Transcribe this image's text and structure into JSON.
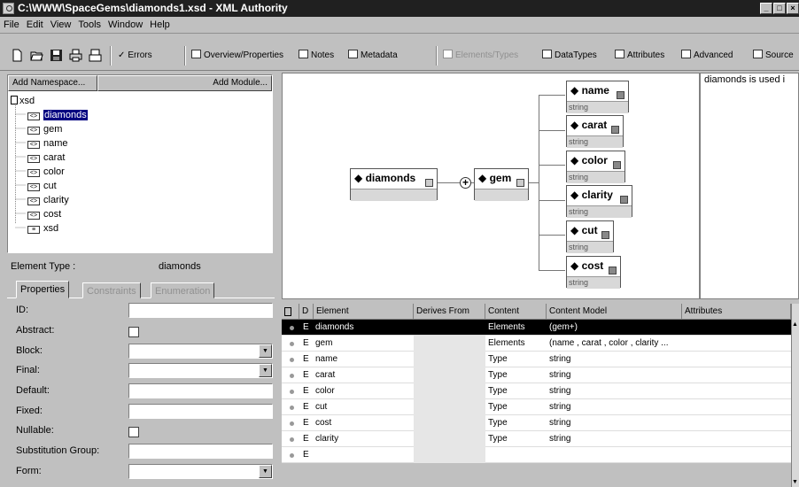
{
  "window": {
    "title": "C:\\WWW\\SpaceGems\\diamonds1.xsd - XML Authority"
  },
  "menu": [
    "File",
    "Edit",
    "View",
    "Tools",
    "Window",
    "Help"
  ],
  "toolbar": {
    "errors": "Errors",
    "overview": "Overview/Properties",
    "notes": "Notes",
    "metadata": "Metadata",
    "elements_types": "Elements/Types",
    "datatypes": "DataTypes",
    "attributes": "Attributes",
    "advanced": "Advanced",
    "source": "Source"
  },
  "tree": {
    "add_namespace": "Add Namespace...",
    "add_module": "Add Module...",
    "root": "xsd",
    "items": [
      "diamonds",
      "gem",
      "name",
      "carat",
      "color",
      "cut",
      "clarity",
      "cost",
      "xsd"
    ],
    "selected_index": 0
  },
  "element_panel": {
    "label": "Element Type :",
    "value": "diamonds",
    "tabs": [
      "Properties",
      "Constraints",
      "Enumeration"
    ],
    "fields": {
      "id": "ID:",
      "abstract": "Abstract:",
      "block": "Block:",
      "final": "Final:",
      "default": "Default:",
      "fixed": "Fixed:",
      "nullable": "Nullable:",
      "subst": "Substitution Group:",
      "form": "Form:"
    }
  },
  "diagram": {
    "root": "diamonds",
    "child": "gem",
    "leaves": [
      {
        "name": "name",
        "type": "string"
      },
      {
        "name": "carat",
        "type": "string"
      },
      {
        "name": "color",
        "type": "string"
      },
      {
        "name": "clarity",
        "type": "string"
      },
      {
        "name": "cut",
        "type": "string"
      },
      {
        "name": "cost",
        "type": "string"
      }
    ]
  },
  "usage": {
    "text": "diamonds is used i"
  },
  "grid": {
    "headers": {
      "d": "D",
      "element": "Element",
      "derives": "Derives From",
      "content": "Content",
      "model": "Content Model",
      "attributes": "Attributes"
    },
    "rows": [
      {
        "d": "E",
        "element": "diamonds",
        "content": "Elements",
        "model": "(gem+)"
      },
      {
        "d": "E",
        "element": "gem",
        "content": "Elements",
        "model": "(name , carat , color , clarity ..."
      },
      {
        "d": "E",
        "element": "name",
        "content": "Type",
        "model": "string"
      },
      {
        "d": "E",
        "element": "carat",
        "content": "Type",
        "model": "string"
      },
      {
        "d": "E",
        "element": "color",
        "content": "Type",
        "model": "string"
      },
      {
        "d": "E",
        "element": "cut",
        "content": "Type",
        "model": "string"
      },
      {
        "d": "E",
        "element": "cost",
        "content": "Type",
        "model": "string"
      },
      {
        "d": "E",
        "element": "clarity",
        "content": "Type",
        "model": "string"
      },
      {
        "d": "E",
        "element": "",
        "content": "",
        "model": ""
      }
    ]
  }
}
